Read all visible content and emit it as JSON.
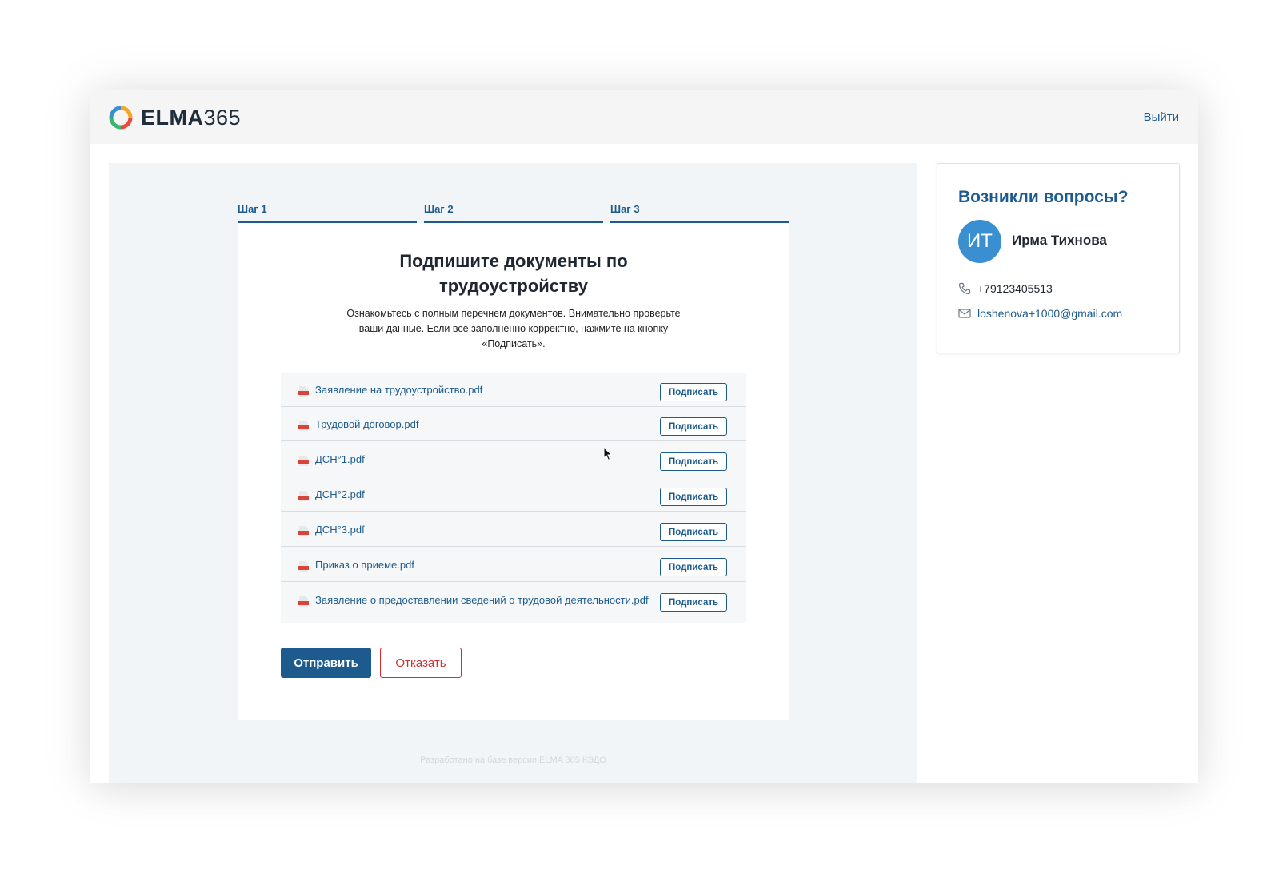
{
  "app": {
    "logo_bold": "ELMA",
    "logo_light": "365",
    "logout_label": "Выйти"
  },
  "steps": [
    {
      "label": "Шаг 1"
    },
    {
      "label": "Шаг 2"
    },
    {
      "label": "Шаг 3"
    }
  ],
  "main": {
    "title_line1": "Подпишите документы по",
    "title_line2": "трудоустройству",
    "description_line1": "Ознакомьтесь с полным перечнем документов. Внимательно проверьте",
    "description_line2": "ваши данные. Если всё заполненно корректно, нажмите на кнопку",
    "description_line3": "«Подписать».",
    "documents": [
      {
        "name": "Заявление на трудоустройство.pdf",
        "action": "Подписать"
      },
      {
        "name": "Трудовой договор.pdf",
        "action": "Подписать"
      },
      {
        "name": "ДСН°1.pdf",
        "action": "Подписать"
      },
      {
        "name": "ДСН°2.pdf",
        "action": "Подписать"
      },
      {
        "name": "ДСН°3.pdf",
        "action": "Подписать"
      },
      {
        "name": "Приказ о приеме.pdf",
        "action": "Подписать"
      },
      {
        "name": "Заявление о предоставлении сведений о трудовой деятельности.pdf",
        "action": "Подписать"
      }
    ],
    "send_label": "Отправить",
    "refuse_label": "Отказать",
    "footer_note": "Разработано на базе версии ELMA 365 КЭДО"
  },
  "contact": {
    "title": "Возникли вопросы?",
    "initials": "ИТ",
    "name": "Ирма Тихнова",
    "phone": "+79123405513",
    "email": "loshenova+1000@gmail.com"
  },
  "colors": {
    "primary": "#1d5b8e",
    "danger": "#d32f2f",
    "avatar": "#3a8fd0",
    "panel_bg": "#f1f5f8"
  },
  "icons": {
    "document": "pdf-file-icon",
    "phone": "phone-icon",
    "email": "mail-icon",
    "logo": "elma-ring-logo"
  }
}
